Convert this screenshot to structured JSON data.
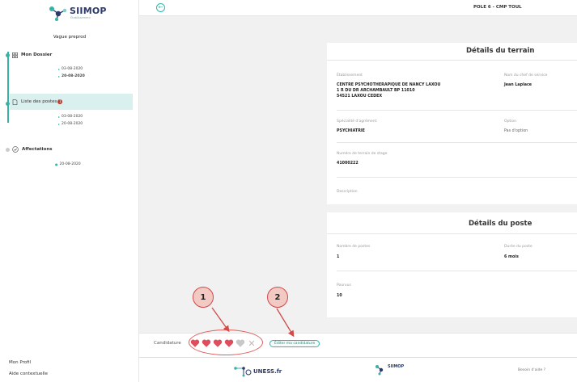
{
  "app": {
    "logo_text": "SIIMOP",
    "logo_sub": "Établissement",
    "brand_color": "#38b2a6",
    "brand_dark": "#2b3a6b"
  },
  "sidebar": {
    "vague_label": "Vague preprod",
    "items": [
      {
        "label": "Mon Dossier",
        "icon": "grid-icon",
        "dates": [
          "03-08-2020",
          "20-08-2020"
        ]
      },
      {
        "label": "Liste des postes",
        "icon": "document-icon",
        "badge": "1",
        "active": true,
        "dates": [
          "03-08-2020",
          "20-08-2020"
        ]
      },
      {
        "label": "Affectations",
        "icon": "check-circle-icon",
        "dates": [
          "20-08-2020"
        ]
      }
    ],
    "bottom_links": [
      "Mon Profil",
      "Aide contextuelle"
    ]
  },
  "topbar": {
    "title": "POLE 6 - CMP TOUL"
  },
  "terrain": {
    "title": "Détails du terrain",
    "etablissement_label": "Établissement",
    "etablissement_lines": [
      "CENTRE PSYCHOTHERAPIQUE DE NANCY LAXOU",
      "1 R DU DR ARCHAMBAULT BP 11010",
      "54521 LAXOU CEDEX"
    ],
    "chef_label": "Nom du chef de service",
    "chef_value": "Jean Laplace",
    "specialite_label": "Spécialité d'agrément",
    "specialite_value": "PSYCHIATRIE",
    "option_label": "Option",
    "option_value": "Pas d'option",
    "numero_label": "Numéro de terrain de stage",
    "numero_value": "41000222",
    "description_label": "Description"
  },
  "poste": {
    "title": "Détails du poste",
    "nombre_label": "Nombre de postes",
    "nombre_value": "1",
    "duree_label": "Durée du poste",
    "duree_value": "6 mois",
    "pourvu_label": "Pourvus",
    "pourvu_value": "10"
  },
  "candidature": {
    "label": "Candidature",
    "rating": 4,
    "rating_max": 5,
    "heart_color": "#e04d5c",
    "heart_empty_color": "#c8c8c8",
    "edit_label": "Éditer ma candidature"
  },
  "annotations": {
    "marker1": "1",
    "marker2": "2",
    "color": "#d04a4a"
  },
  "footer": {
    "uness_label": "UNESS.fr",
    "silmop_label": "SIIMOP",
    "help_label": "Besoin d'aide ?"
  }
}
